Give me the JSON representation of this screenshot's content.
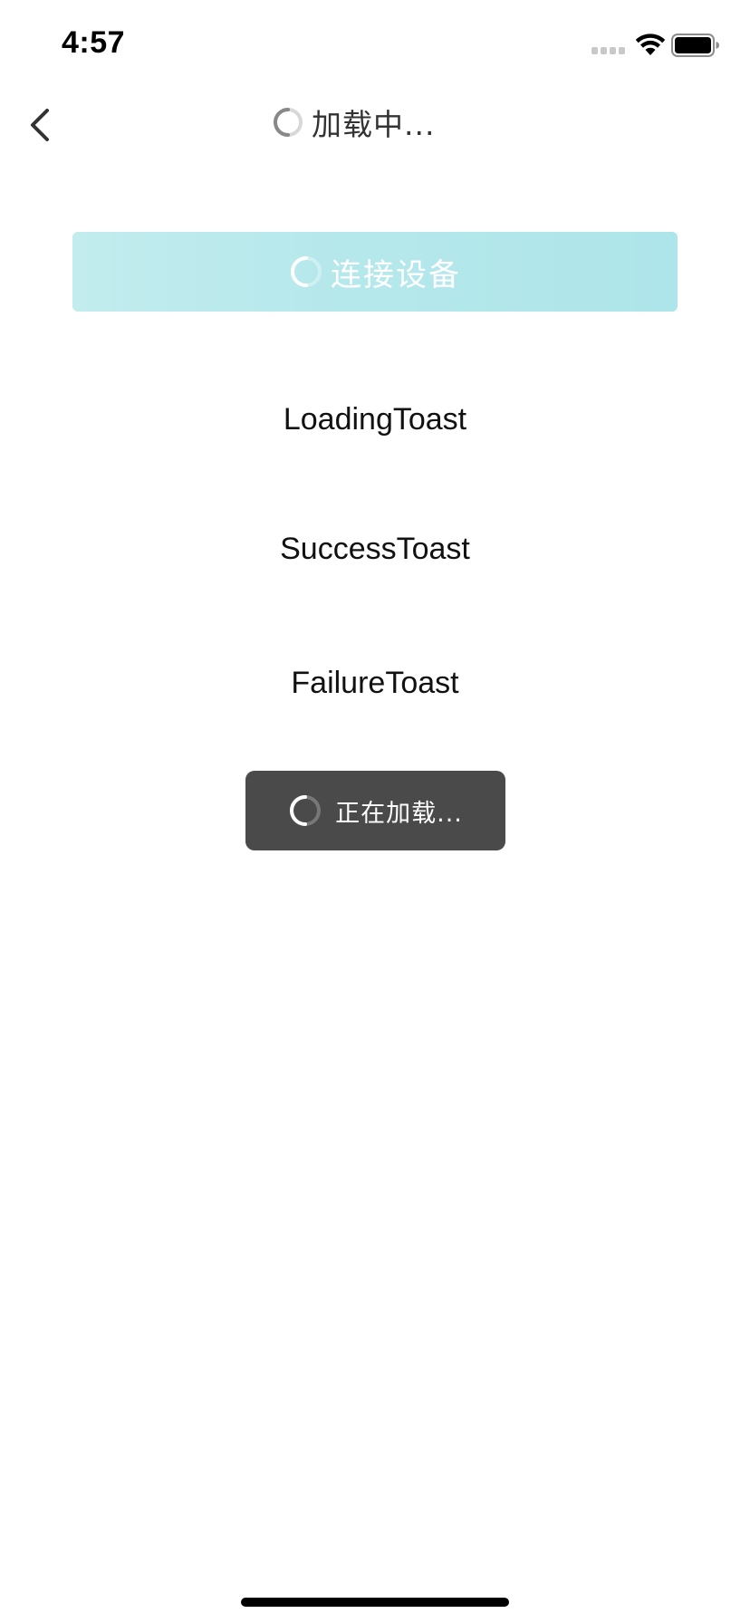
{
  "status_bar": {
    "time": "4:57",
    "colors": {
      "text": "#000000",
      "signal_inactive": "#c8c8c8"
    },
    "icons": [
      "cellular-signal-icon",
      "wifi-icon",
      "battery-icon"
    ]
  },
  "nav": {
    "title": "加载中...",
    "icons": [
      "chevron-left-icon",
      "spinner-icon"
    ]
  },
  "connect_button": {
    "label": "连接设备",
    "icon": "spinner-icon",
    "colors": {
      "gradient_start": "#c2ecee",
      "gradient_end": "#aee5ea",
      "text": "#ffffff"
    }
  },
  "demos": [
    {
      "label": "LoadingToast"
    },
    {
      "label": "SuccessToast"
    },
    {
      "label": "FailureToast"
    }
  ],
  "toast": {
    "label": "正在加载...",
    "icon": "spinner-icon",
    "colors": {
      "background": "#4a4a4a",
      "text": "#ffffff"
    }
  }
}
